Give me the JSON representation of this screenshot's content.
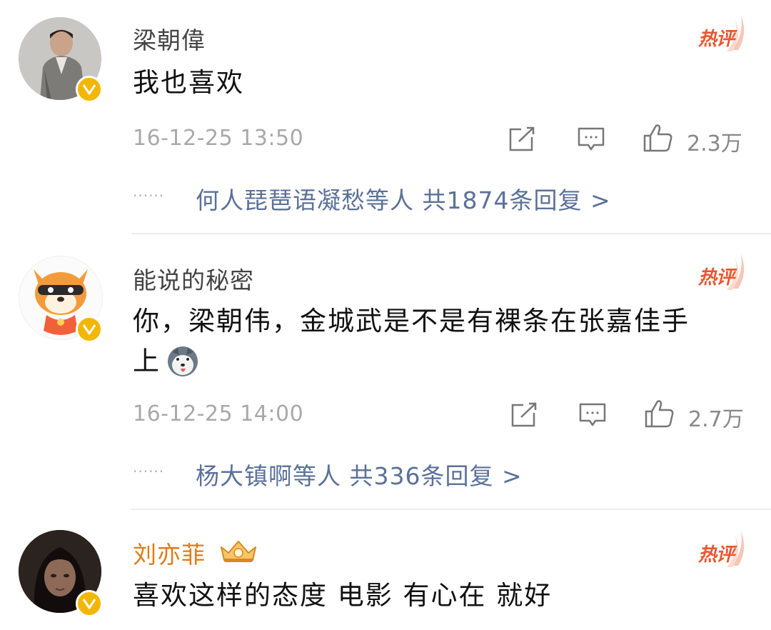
{
  "hot_label": "热评",
  "comments": [
    {
      "username": "梁朝偉",
      "text": "我也喜欢",
      "time": "16-12-25 13:50",
      "likes": "2.3万",
      "reply_dots": "······",
      "replies": "何人琵琶语凝愁等人 共1874条回复 >",
      "verified": true
    },
    {
      "username": "能说的秘密",
      "text_line1": "你，梁朝伟，金城武是不是有裸条在张嘉佳手",
      "text_line2": "上",
      "time": "16-12-25 14:00",
      "likes": "2.7万",
      "reply_dots": "······",
      "replies": "杨大镇啊等人 共336条回复 >",
      "verified": true,
      "emoji": "husky-emoji"
    },
    {
      "username": "刘亦菲",
      "text": "喜欢这样的态度 电影 有心在 就好",
      "verified": true,
      "badge": "crown-icon"
    }
  ],
  "colors": {
    "hot": "#e8572f",
    "verified_badge": "#f2b704",
    "reply_link": "#5b7199",
    "vip_name": "#e07b1a"
  }
}
